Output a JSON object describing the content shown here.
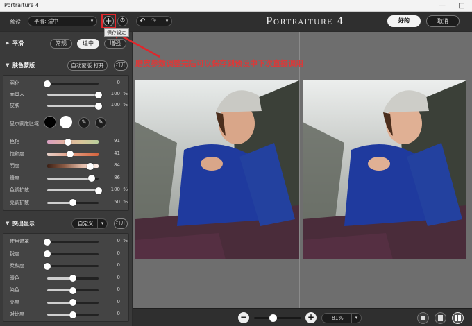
{
  "window": {
    "title": "Portraiture 4"
  },
  "toolbar": {
    "preset_label": "预设",
    "preset_value": "平滑: 适中",
    "tooltip": "保存设定",
    "brand": "Portraiture 4",
    "ok_label": "好的",
    "cancel_label": "取消"
  },
  "annotation": {
    "text": "磨皮参数调整完后可以保存到预设中下次直接调用",
    "color": "#d83a3a"
  },
  "smoothing": {
    "title": "平滑",
    "options": [
      "常规",
      "适中",
      "增强"
    ],
    "selected_index": 1
  },
  "skin_mask": {
    "title": "肤色蒙版",
    "auto_label": "自动蒙版 打开",
    "toggle_label": "打开",
    "sliders": [
      {
        "name": "羽化",
        "value": "0",
        "unit": "",
        "pos": 0.0
      },
      {
        "name": "面具人",
        "value": "100",
        "unit": "%",
        "pos": 1.0
      },
      {
        "name": "皮肤",
        "value": "100",
        "unit": "%",
        "pos": 1.0
      }
    ],
    "show_mask_label": "显示蒙版区域",
    "color_sliders": [
      {
        "name": "色相",
        "value": "91",
        "unit": "",
        "pos": 0.4
      },
      {
        "name": "饱和度",
        "value": "41",
        "unit": "",
        "pos": 0.45
      },
      {
        "name": "明度",
        "value": "84",
        "unit": "",
        "pos": 0.84
      },
      {
        "name": "缝度",
        "value": "86",
        "unit": "",
        "pos": 0.86
      },
      {
        "name": "色调扩散",
        "value": "100",
        "unit": "%",
        "pos": 1.0
      },
      {
        "name": "亮调扩散",
        "value": "50",
        "unit": "%",
        "pos": 0.5
      }
    ]
  },
  "enhance": {
    "title": "突出显示",
    "preset_value": "自定义",
    "toggle_label": "打开",
    "sliders": [
      {
        "name": "使用遮罩",
        "value": "0",
        "unit": "%",
        "pos": 0.0
      },
      {
        "name": "锐度",
        "value": "0",
        "unit": "",
        "pos": 0.0
      },
      {
        "name": "柔和度",
        "value": "0",
        "unit": "",
        "pos": 0.0
      },
      {
        "name": "暖色",
        "value": "0",
        "unit": "",
        "pos": 0.5
      },
      {
        "name": "染色",
        "value": "0",
        "unit": "",
        "pos": 0.5
      },
      {
        "name": "亮度",
        "value": "0",
        "unit": "",
        "pos": 0.5
      },
      {
        "name": "对比度",
        "value": "0",
        "unit": "",
        "pos": 0.5
      }
    ]
  },
  "zoom": {
    "value": "81%",
    "level": 0.4
  }
}
